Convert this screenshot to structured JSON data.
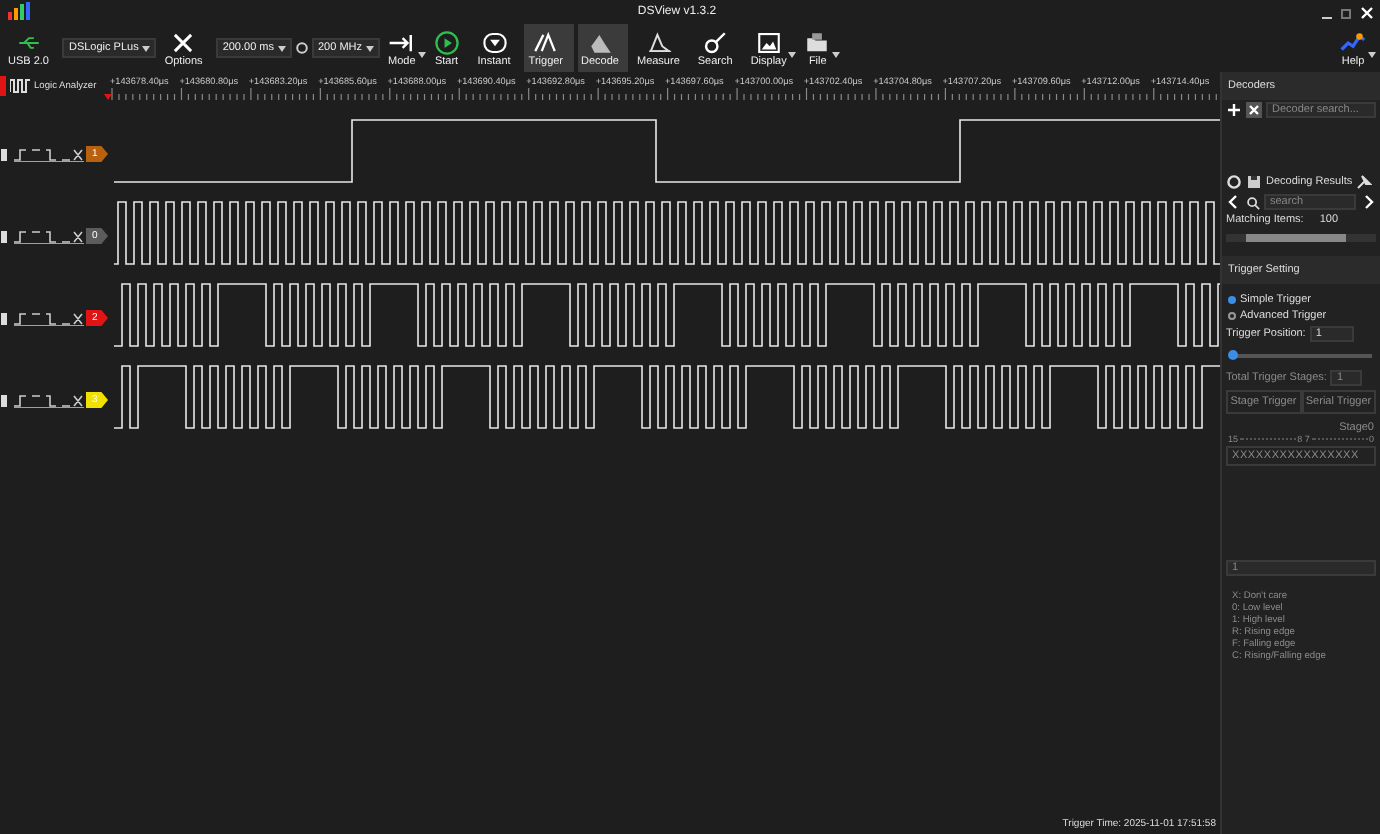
{
  "window": {
    "title": "DSView v1.3.2"
  },
  "toolbar": {
    "usb_label": "USB 2.0",
    "device": "DSLogic PLus",
    "options": "Options",
    "duration": "200.00 ms",
    "rate": "200 MHz",
    "tools": [
      {
        "kind": "mode",
        "label": "Mode",
        "active": false,
        "menu": true
      },
      {
        "kind": "start",
        "label": "Start",
        "active": false,
        "menu": false
      },
      {
        "kind": "instant",
        "label": "Instant",
        "active": false,
        "menu": false
      },
      {
        "kind": "trigger",
        "label": "Trigger",
        "active": true,
        "menu": false
      },
      {
        "kind": "decode",
        "label": "Decode",
        "active": true,
        "menu": false
      },
      {
        "kind": "measure",
        "label": "Measure",
        "active": false,
        "menu": false
      },
      {
        "kind": "search",
        "label": "Search",
        "active": false,
        "menu": false
      },
      {
        "kind": "display",
        "label": "Display",
        "active": false,
        "menu": true
      },
      {
        "kind": "file",
        "label": "File",
        "active": false,
        "menu": true
      }
    ],
    "help": "Help"
  },
  "ruler": {
    "mode": "Logic Analyzer",
    "labels": [
      "+143678.40μs",
      "+143680.80μs",
      "+143683.20μs",
      "+143685.60μs",
      "+143688.00μs",
      "+143690.40μs",
      "+143692.80μs",
      "+143695.20μs",
      "+143697.60μs",
      "+143700.00μs",
      "+143702.40μs",
      "+143704.80μs",
      "+143707.20μs",
      "+143709.60μs",
      "+143712.00μs",
      "+143714.40μs"
    ]
  },
  "channels": [
    {
      "label": "1",
      "color": "#b8620f",
      "kind": "slow"
    },
    {
      "label": "0",
      "color": "#5c5c5c",
      "kind": "clock"
    },
    {
      "label": "2",
      "color": "#e01414",
      "kind": "burst"
    },
    {
      "label": "3",
      "color": "#f2e000",
      "kind": "burst"
    }
  ],
  "status": "Trigger Time: 2025-11-01 17:51:58",
  "decoders": {
    "title": "Decoders",
    "search_placeholder": "Decoder search...",
    "results_title": "Decoding Results",
    "results_search_placeholder": "search",
    "matching_label": "Matching Items:",
    "matching_value": "100"
  },
  "trigger": {
    "title": "Trigger Setting",
    "modes": [
      {
        "label": "Simple Trigger",
        "selected": true
      },
      {
        "label": "Advanced Trigger",
        "selected": false
      }
    ],
    "position_label": "Trigger Position:",
    "position_value": "1",
    "position_slider": {
      "level": 0.02
    },
    "advanced_disabled": true,
    "stages_label": "Total Trigger Stages:",
    "stages_value": "1",
    "tabs": [
      {
        "label": "Stage Trigger",
        "selected": false
      },
      {
        "label": "Serial Trigger",
        "selected": false
      }
    ],
    "stage_title": "Stage0",
    "bit_scale": [
      "15",
      "8 7",
      "0"
    ],
    "pattern": "XXXXXXXXXXXXXXXX",
    "value_field": "1",
    "legend": [
      "X: Don't care",
      "0: Low level",
      "1: High level",
      "R: Rising edge",
      "F: Falling edge",
      "C: Rising/Falling edge"
    ]
  }
}
